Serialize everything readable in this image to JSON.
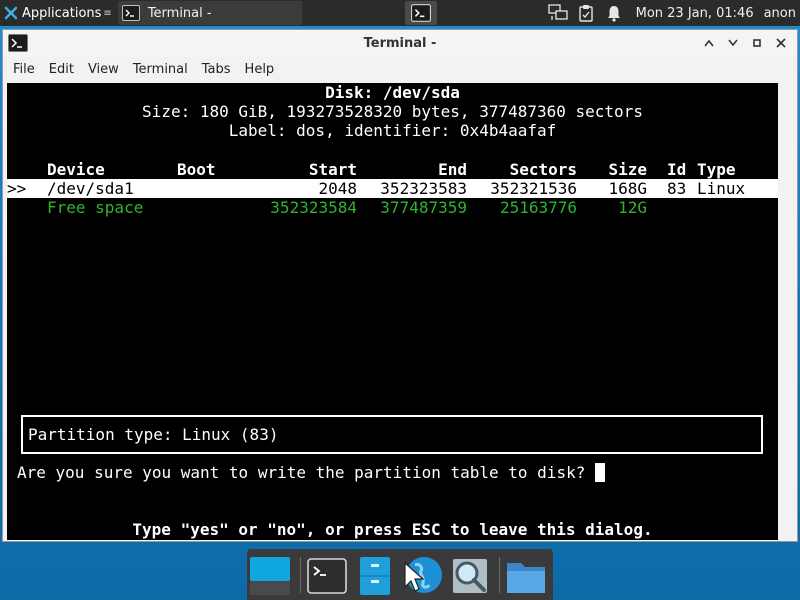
{
  "panel": {
    "applications_label": "Applications",
    "task_title": "Terminal -",
    "clock": "Mon 23 Jan, 01:46",
    "user": "anon"
  },
  "window": {
    "title": "Terminal -",
    "menu": [
      "File",
      "Edit",
      "View",
      "Terminal",
      "Tabs",
      "Help"
    ]
  },
  "terminal": {
    "disk_line": "Disk: /dev/sda",
    "size_line": "Size: 180 GiB, 193273528320 bytes, 377487360 sectors",
    "label_line": "Label: dos, identifier: 0x4b4aafaf",
    "headers": {
      "device": "Device",
      "boot": "Boot",
      "start": "Start",
      "end": "End",
      "sectors": "Sectors",
      "size": "Size",
      "id": "Id",
      "type": "Type"
    },
    "selected_marker": ">>",
    "partition": {
      "device": "/dev/sda1",
      "start": "2048",
      "end": "352323583",
      "sectors": "352321536",
      "size": "168G",
      "id": "83",
      "type": "Linux"
    },
    "free": {
      "device": "Free space",
      "start": "352323584",
      "end": "377487359",
      "sectors": "25163776",
      "size": "12G"
    },
    "partition_type_box": "Partition type: Linux (83)",
    "prompt": "Are you sure you want to write the partition table to disk? ",
    "hint": "Type \"yes\" or \"no\", or press ESC to leave this dialog."
  },
  "colors": {
    "free_space_green": "#2fb42f",
    "desktop_blue": "#1577b6",
    "panel_dark": "#2b2b2b"
  },
  "dock": {
    "items": [
      "show-desktop-icon",
      "terminal-icon",
      "file-manager-icon",
      "web-browser-icon",
      "app-finder-icon",
      "folder-icon"
    ]
  }
}
